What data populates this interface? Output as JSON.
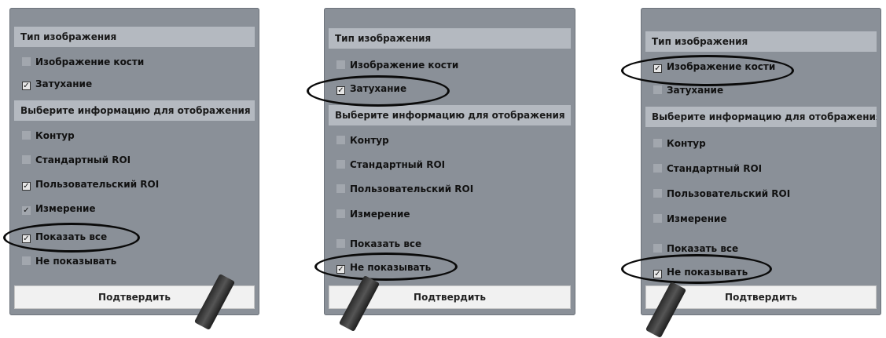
{
  "panels": [
    {
      "image_type_header": "Тип изображения",
      "image_type_options": [
        {
          "label": "Изображение кости",
          "checked": false
        },
        {
          "label": "Затухание",
          "checked": true
        }
      ],
      "info_header": "Выберите информацию для отображения",
      "info_options": [
        {
          "label": "Контур",
          "checked": false
        },
        {
          "label": "Стандартный ROI",
          "checked": false
        },
        {
          "label": "Пользовательский ROI",
          "checked": true
        },
        {
          "label": "Измерение",
          "checked": true
        }
      ],
      "show_all": {
        "label": "Показать все",
        "checked": true
      },
      "hide_all": {
        "label": "Не показывать",
        "checked": false
      },
      "confirm_label": "Подтвердить"
    },
    {
      "image_type_header": "Тип изображения",
      "image_type_options": [
        {
          "label": "Изображение кости",
          "checked": false
        },
        {
          "label": "Затухание",
          "checked": true
        }
      ],
      "info_header": "Выберите информацию для отображения",
      "info_options": [
        {
          "label": "Контур",
          "checked": false
        },
        {
          "label": "Стандартный ROI",
          "checked": false
        },
        {
          "label": "Пользовательский ROI",
          "checked": false
        },
        {
          "label": "Измерение",
          "checked": false
        }
      ],
      "show_all": {
        "label": "Показать все",
        "checked": false
      },
      "hide_all": {
        "label": "Не показывать",
        "checked": true
      },
      "confirm_label": "Подтвердить"
    },
    {
      "image_type_header": "Тип изображения",
      "image_type_options": [
        {
          "label": "Изображение кости",
          "checked": true
        },
        {
          "label": "Затухание",
          "checked": false
        }
      ],
      "info_header": "Выберите информацию для отображения",
      "info_options": [
        {
          "label": "Контур",
          "checked": false
        },
        {
          "label": "Стандартный ROI",
          "checked": false
        },
        {
          "label": "Пользовательский ROI",
          "checked": false
        },
        {
          "label": "Измерение",
          "checked": false
        }
      ],
      "show_all": {
        "label": "Показать все",
        "checked": false
      },
      "hide_all": {
        "label": "Не показывать",
        "checked": true
      },
      "confirm_label": "Подтвердить"
    }
  ]
}
